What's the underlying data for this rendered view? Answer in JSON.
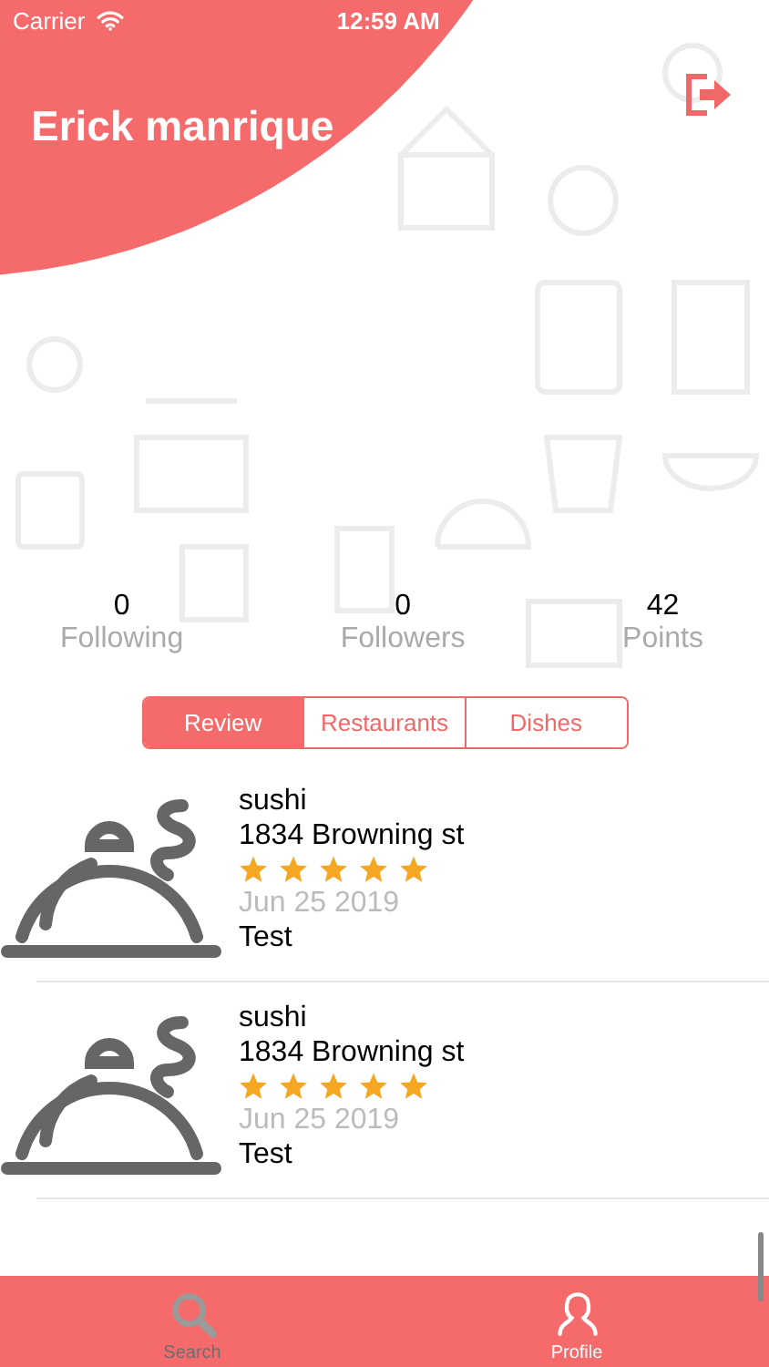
{
  "status_bar": {
    "carrier": "Carrier",
    "time": "12:59 AM"
  },
  "profile": {
    "name": "Erick manrique"
  },
  "stats": [
    {
      "value": "0",
      "label": "Following"
    },
    {
      "value": "0",
      "label": "Followers"
    },
    {
      "value": "42",
      "label": "Points"
    }
  ],
  "segments": [
    {
      "label": "Review",
      "selected": true
    },
    {
      "label": "Restaurants",
      "selected": false
    },
    {
      "label": "Dishes",
      "selected": false
    }
  ],
  "reviews": [
    {
      "restaurant": "sushi",
      "address": "1834 Browning st",
      "stars": 5,
      "date": "Jun 25 2019",
      "text": "Test"
    },
    {
      "restaurant": "sushi",
      "address": "1834 Browning st",
      "stars": 5,
      "date": "Jun 25 2019",
      "text": "Test"
    }
  ],
  "tab_bar": [
    {
      "label": "Search",
      "kind": "search",
      "selected": false
    },
    {
      "label": "Profile",
      "kind": "profile",
      "selected": true
    }
  ]
}
